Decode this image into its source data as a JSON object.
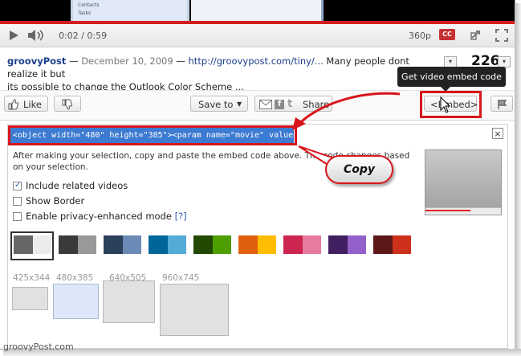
{
  "player": {
    "thumb_rows": [
      "Contacts",
      "Tasks"
    ],
    "time": "0:02 / 0:59",
    "quality": "360p",
    "cc_label": "CC"
  },
  "video_info": {
    "author": "groovyPost",
    "separator1": " — ",
    "date": "December 10, 2009",
    "separator2": " — ",
    "link": "http://groovypost.com/tiny/...",
    "description_line1": " Many people dont realize it but",
    "description_line2": "its possible to change the Outlook Color Scheme ...",
    "view_count": "226"
  },
  "tooltip": "Get video embed code",
  "actions": {
    "like": "Like",
    "save_to": "Save to",
    "share": "Share",
    "embed": "<Embed>"
  },
  "embed": {
    "code": "<object width=\"480\" height=\"385\"><param name=\"movie\" value=",
    "close": "×",
    "instructions": "After making your selection, copy and paste the embed code above. The code changes based on your selection.",
    "options": [
      {
        "label": "Include related videos",
        "checked": true
      },
      {
        "label": "Show Border",
        "checked": false
      },
      {
        "label": "Enable privacy-enhanced mode",
        "checked": false,
        "help": "[?]"
      }
    ],
    "color_swatches": [
      {
        "a": "#666666",
        "b": "#ececec",
        "selected": true
      },
      {
        "a": "#3a3a3a",
        "b": "#999999"
      },
      {
        "a": "#2b405b",
        "b": "#6b8ab6"
      },
      {
        "a": "#006699",
        "b": "#54abd6"
      },
      {
        "a": "#234900",
        "b": "#4e9e00"
      },
      {
        "a": "#e1600f",
        "b": "#febd01"
      },
      {
        "a": "#cc2550",
        "b": "#e87a9f"
      },
      {
        "a": "#402061",
        "b": "#9461ca"
      },
      {
        "a": "#5d1719",
        "b": "#cd311b"
      }
    ],
    "sizes": [
      "425x344",
      "480x385",
      "640x505",
      "960x745"
    ],
    "selected_size": "480x385"
  },
  "callout": "Copy",
  "watermark": "groovyPost.com"
}
